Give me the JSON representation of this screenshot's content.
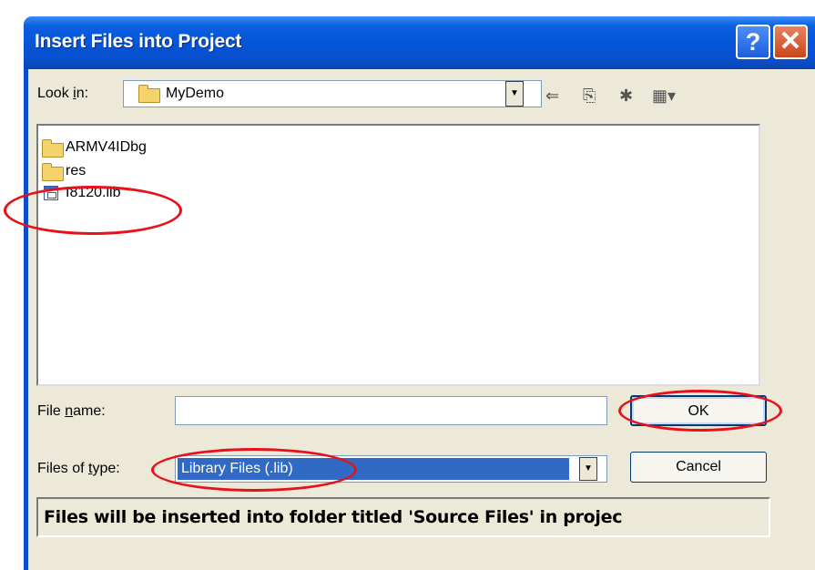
{
  "dialog": {
    "title": "Insert Files into Project",
    "help_glyph": "?",
    "close_glyph": "✕"
  },
  "look_in": {
    "label_pre": "Look ",
    "label_ul": "i",
    "label_post": "n:",
    "value": "MyDemo"
  },
  "files": [
    {
      "name": "ARMV4IDbg",
      "icon": "folder-icon"
    },
    {
      "name": "res",
      "icon": "folder-icon"
    },
    {
      "name": "I8120.lib",
      "icon": "library-file-icon"
    }
  ],
  "file_name": {
    "label_pre": "File ",
    "label_ul": "n",
    "label_post": "ame:",
    "value": "",
    "placeholder": ""
  },
  "files_of_type": {
    "label_pre": "Files of ",
    "label_ul": "t",
    "label_post": "ype:",
    "value": "Library Files (.lib)"
  },
  "buttons": {
    "ok": "OK",
    "cancel": "Cancel"
  },
  "info_text": "Files will be inserted into folder titled 'Source Files' in projec",
  "colors": {
    "title_bar": "#0554d8",
    "dialog_bg": "#ece9d8",
    "selection": "#316ac5",
    "highlight_ring": "#e8101a"
  }
}
